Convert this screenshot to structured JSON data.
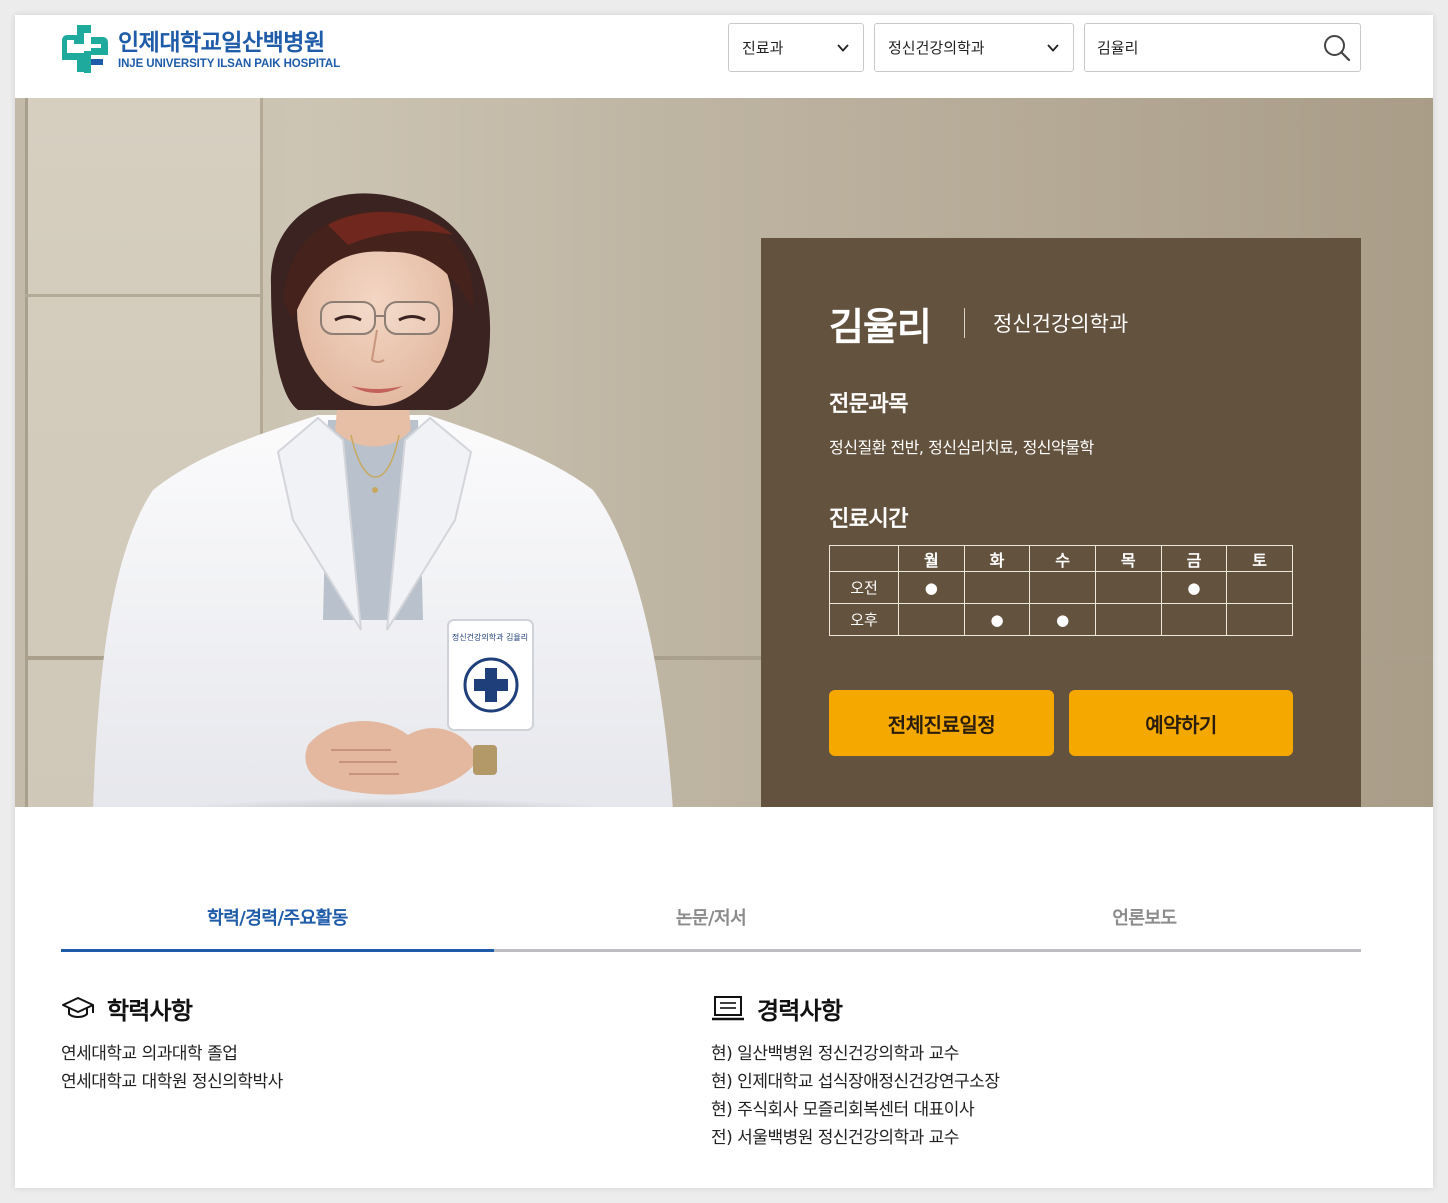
{
  "brand": {
    "name_ko": "인제대학교일산백병원",
    "name_en": "INJE UNIVERSITY  ILSAN PAIK HOSPITAL",
    "color": "#1e5ba8",
    "accent": "#1faa9e"
  },
  "search": {
    "category_select": "진료과",
    "department_select": "정신건강의학과",
    "query_value": "김율리"
  },
  "doctor": {
    "name": "김율리",
    "department": "정신건강의학과",
    "specialty_title": "전문과목",
    "specialty": "정신질환 전반, 정신심리치료, 정신약물학",
    "schedule_title": "진료시간",
    "schedule": {
      "days": [
        "월",
        "화",
        "수",
        "목",
        "금",
        "토"
      ],
      "rows": [
        {
          "label": "오전",
          "slots": [
            "●",
            "",
            "",
            "",
            "●",
            ""
          ]
        },
        {
          "label": "오후",
          "slots": [
            "",
            "●",
            "●",
            "",
            "",
            ""
          ]
        }
      ]
    },
    "buttons": {
      "full_schedule": "전체진료일정",
      "reserve": "예약하기"
    },
    "panel_color": "#63523e",
    "button_color": "#f5a800"
  },
  "tabs": [
    {
      "label": "학력/경력/주요활동",
      "active": true
    },
    {
      "label": "논문/저서",
      "active": false
    },
    {
      "label": "언론보도",
      "active": false
    }
  ],
  "education": {
    "title": "학력사항",
    "items": [
      "연세대학교 의과대학 졸업",
      "연세대학교 대학원 정신의학박사"
    ]
  },
  "career": {
    "title": "경력사항",
    "items": [
      "현) 일산백병원 정신건강의학과 교수",
      "현) 인제대학교 섭식장애정신건강연구소장",
      "현) 주식회사 모즐리회복센터 대표이사",
      "전) 서울백병원 정신건강의학과 교수"
    ]
  }
}
